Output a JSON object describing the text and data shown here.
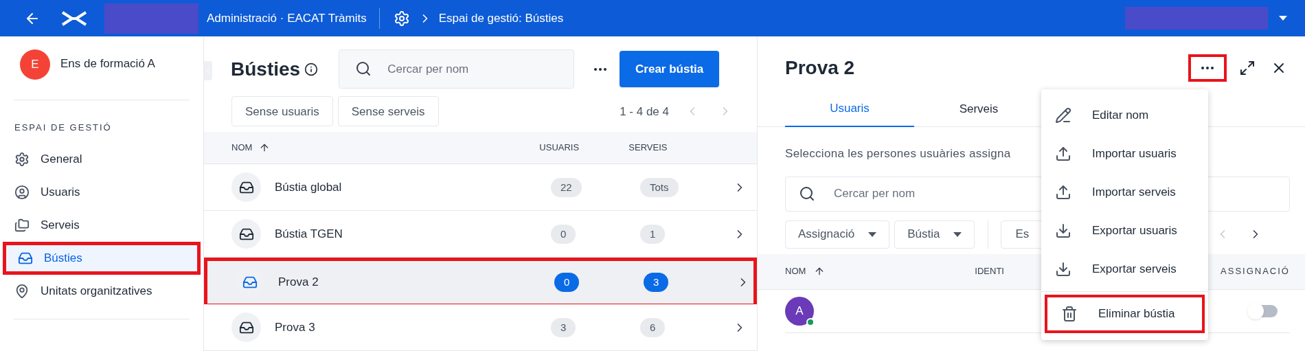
{
  "top_bar": {
    "title": "Administració · EACAT Tràmits",
    "breadcrumb": "Espai de gestió: Bústies"
  },
  "sidebar": {
    "organization": {
      "initial": "E",
      "name": "Ens de formació A"
    },
    "section_title": "ESPAI DE GESTIÓ",
    "items": [
      {
        "label": "General",
        "kind": "gear",
        "selected": false,
        "highlighted": false
      },
      {
        "label": "Usuaris",
        "kind": "user",
        "selected": false,
        "highlighted": false
      },
      {
        "label": "Serveis",
        "kind": "folder",
        "selected": false,
        "highlighted": false
      },
      {
        "label": "Bústies",
        "kind": "inbox",
        "selected": true,
        "highlighted": true
      },
      {
        "label": "Unitats organitzatives",
        "kind": "pin",
        "selected": false,
        "highlighted": false
      }
    ]
  },
  "list_panel": {
    "title": "Bústies",
    "search": {
      "placeholder": "Cercar per nom"
    },
    "create_button": "Crear bústia",
    "filters": [
      "Sense usuaris",
      "Sense serveis"
    ],
    "pagination": "1 - 4 de 4",
    "columns": [
      "NOM",
      "USUARIS",
      "SERVEIS"
    ],
    "rows": [
      {
        "name": "Bústia global",
        "users": "22",
        "services": "Tots",
        "selected": false,
        "highlighted": false
      },
      {
        "name": "Bústia TGEN",
        "users": "0",
        "services": "1",
        "selected": false,
        "highlighted": false
      },
      {
        "name": "Prova 2",
        "users": "0",
        "services": "3",
        "selected": true,
        "highlighted": true
      },
      {
        "name": "Prova 3",
        "users": "3",
        "services": "6",
        "selected": false,
        "highlighted": false
      }
    ]
  },
  "detail_panel": {
    "title": "Prova 2",
    "more_highlighted": true,
    "tabs": [
      {
        "label": "Usuaris",
        "selected": true
      },
      {
        "label": "Serveis",
        "selected": false
      }
    ],
    "description": "Selecciona les persones usuàries assigna",
    "search": {
      "placeholder": "Cercar per nom"
    },
    "filters": [
      {
        "label": "Assignació",
        "kind": "dropdown"
      },
      {
        "label": "Bústia",
        "kind": "dropdown"
      },
      {
        "label": "Es",
        "kind": "button"
      }
    ],
    "columns": [
      "NOM",
      "IDENTI",
      "ASSIGNACIÓ"
    ],
    "rows": [
      {
        "initial": "A",
        "online": true,
        "on": false
      }
    ]
  },
  "menu": {
    "items": [
      {
        "label": "Editar nom",
        "kind": "edit",
        "highlighted": false
      },
      {
        "label": "Importar usuaris",
        "kind": "upload",
        "highlighted": false
      },
      {
        "label": "Importar serveis",
        "kind": "upload",
        "highlighted": false
      },
      {
        "label": "Exportar usuaris",
        "kind": "download",
        "highlighted": false
      },
      {
        "label": "Exportar serveis",
        "kind": "download",
        "highlighted": false
      },
      {
        "label": "Eliminar bústia",
        "kind": "delete",
        "highlighted": true
      }
    ]
  }
}
